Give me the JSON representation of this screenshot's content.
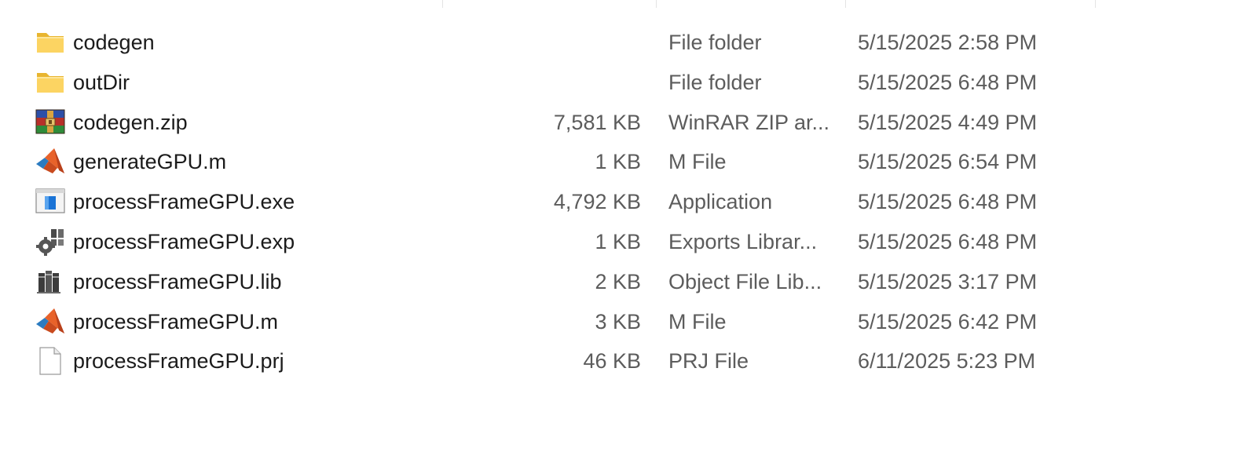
{
  "files": [
    {
      "name": "codegen",
      "size": "",
      "type": "File folder",
      "date": "5/15/2025 2:58 PM",
      "icon": "folder-icon"
    },
    {
      "name": "outDir",
      "size": "",
      "type": "File folder",
      "date": "5/15/2025 6:48 PM",
      "icon": "folder-icon"
    },
    {
      "name": "codegen.zip",
      "size": "7,581 KB",
      "type": "WinRAR ZIP ar...",
      "date": "5/15/2025 4:49 PM",
      "icon": "winrar-archive-icon"
    },
    {
      "name": "generateGPU.m",
      "size": "1 KB",
      "type": "M File",
      "date": "5/15/2025 6:54 PM",
      "icon": "matlab-icon"
    },
    {
      "name": "processFrameGPU.exe",
      "size": "4,792 KB",
      "type": "Application",
      "date": "5/15/2025 6:48 PM",
      "icon": "application-icon"
    },
    {
      "name": "processFrameGPU.exp",
      "size": "1 KB",
      "type": "Exports Librar...",
      "date": "5/15/2025 6:48 PM",
      "icon": "exports-library-icon"
    },
    {
      "name": "processFrameGPU.lib",
      "size": "2 KB",
      "type": "Object File Lib...",
      "date": "5/15/2025 3:17 PM",
      "icon": "library-icon"
    },
    {
      "name": "processFrameGPU.m",
      "size": "3 KB",
      "type": "M File",
      "date": "5/15/2025 6:42 PM",
      "icon": "matlab-icon"
    },
    {
      "name": "processFrameGPU.prj",
      "size": "46 KB",
      "type": "PRJ File",
      "date": "6/11/2025 5:23 PM",
      "icon": "generic-file-icon"
    }
  ]
}
